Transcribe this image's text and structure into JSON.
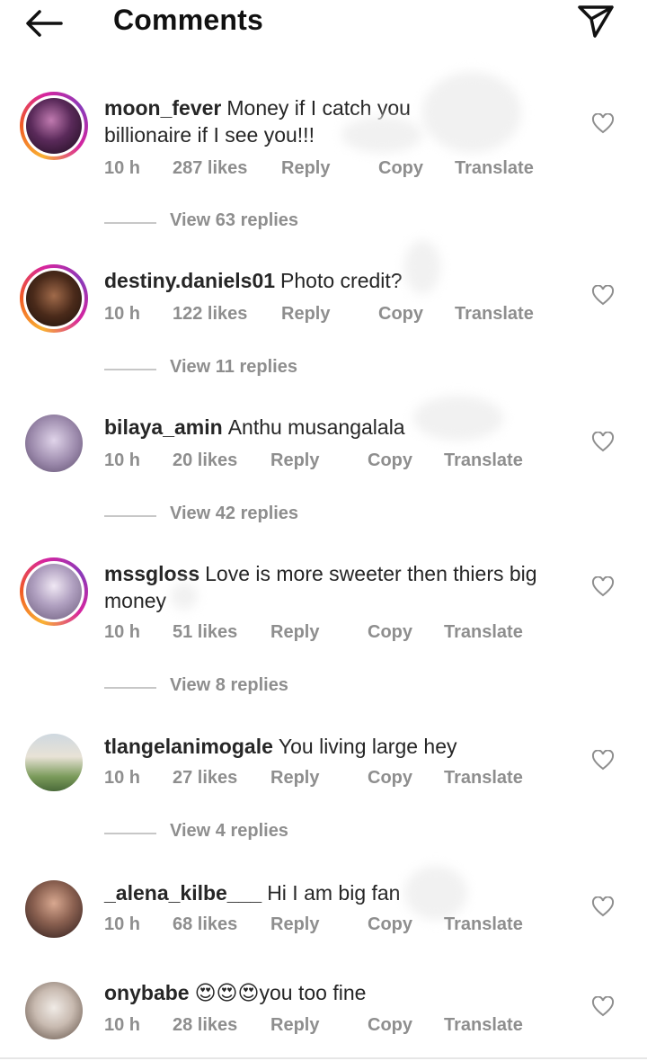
{
  "header": {
    "title": "Comments",
    "back_icon": "arrow-left-icon",
    "share_icon": "paper-plane-icon"
  },
  "meta_labels": {
    "reply": "Reply",
    "copy": "Copy",
    "translate": "Translate"
  },
  "comments": [
    {
      "username": "moon_fever",
      "text": "Money if I catch you billionaire if I see you!!!",
      "time": "10 h",
      "likes": "287 likes",
      "replies": "View 63 replies",
      "story_ring": true,
      "avatar_colors": [
        "#3a1f3a",
        "#a04a8a"
      ]
    },
    {
      "username": "destiny.daniels01",
      "text": "Photo credit?",
      "time": "10 h",
      "likes": "122 likes",
      "replies": "View 11 replies",
      "story_ring": true,
      "avatar_colors": [
        "#2a1a14",
        "#8a5a3a"
      ]
    },
    {
      "username": "bilaya_amin",
      "text": "Anthu musangalala",
      "time": "10 h",
      "likes": "20 likes",
      "replies": "View 42 replies",
      "story_ring": false,
      "avatar_colors": [
        "#7a6a8a",
        "#c9b9d9"
      ]
    },
    {
      "username": "mssgloss",
      "text": "Love is more sweeter then thiers big money",
      "time": "10 h",
      "likes": "51 likes",
      "replies": "View 8 replies",
      "story_ring": true,
      "avatar_colors": [
        "#6a5a7a",
        "#d8d0e0"
      ]
    },
    {
      "username": "tlangelanimogale",
      "text": "You living large hey",
      "time": "10 h",
      "likes": "27 likes",
      "replies": "View 4 replies",
      "story_ring": false,
      "avatar_colors": [
        "#5a7a4a",
        "#c8c0b0"
      ]
    },
    {
      "username": "_alena_kilbe___",
      "text": "Hi I am big fan",
      "time": "10 h",
      "likes": "68 likes",
      "replies": "",
      "story_ring": false,
      "avatar_colors": [
        "#3a2a2a",
        "#c9a090"
      ]
    },
    {
      "username": "onybabe",
      "text": "😍😍😍you too fine",
      "time": "10 h",
      "likes": "28 likes",
      "replies": "",
      "story_ring": false,
      "avatar_colors": [
        "#6a5a4a",
        "#e0d8d0"
      ]
    }
  ]
}
